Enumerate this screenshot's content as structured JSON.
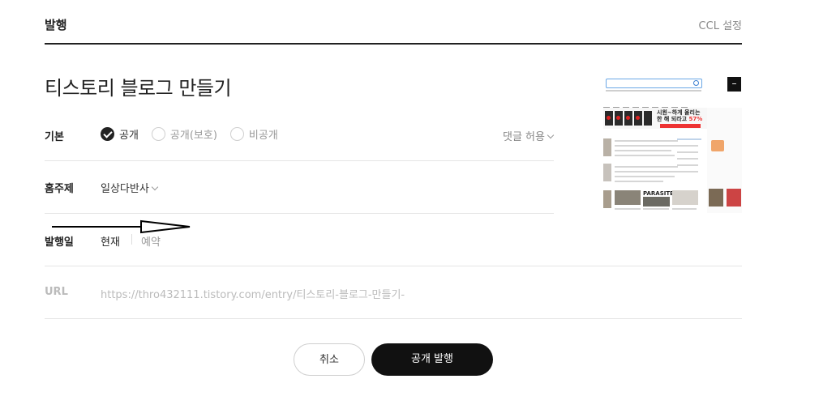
{
  "header": {
    "title": "발행",
    "ccl_label": "CCL 설정"
  },
  "post": {
    "title": "티스토리 블로그 만들기"
  },
  "visibility": {
    "label": "기본",
    "options": [
      "공개",
      "공개(보호)",
      "비공개"
    ],
    "selected": "공개"
  },
  "comment": {
    "label": "댓글 허용"
  },
  "category": {
    "label": "홈주제",
    "value": "일상다반사"
  },
  "publish_date": {
    "label": "발행일",
    "now": "현재",
    "reserve": "예약"
  },
  "url": {
    "label": "URL",
    "value": "https://thro432111.tistory.com/entry/티스토리-블로그-만들기-"
  },
  "thumbnail": {
    "banner_line1": "시원~하게 올리는",
    "banner_line2_prefix": "한 해 되라고 ",
    "banner_line2_highlight": "57%",
    "caption": "PARASITE",
    "close_icon": "minus-icon"
  },
  "actions": {
    "cancel": "취소",
    "publish": "공개 발행"
  },
  "colors": {
    "primary_button": "#111111",
    "accent_red": "#e33333"
  }
}
